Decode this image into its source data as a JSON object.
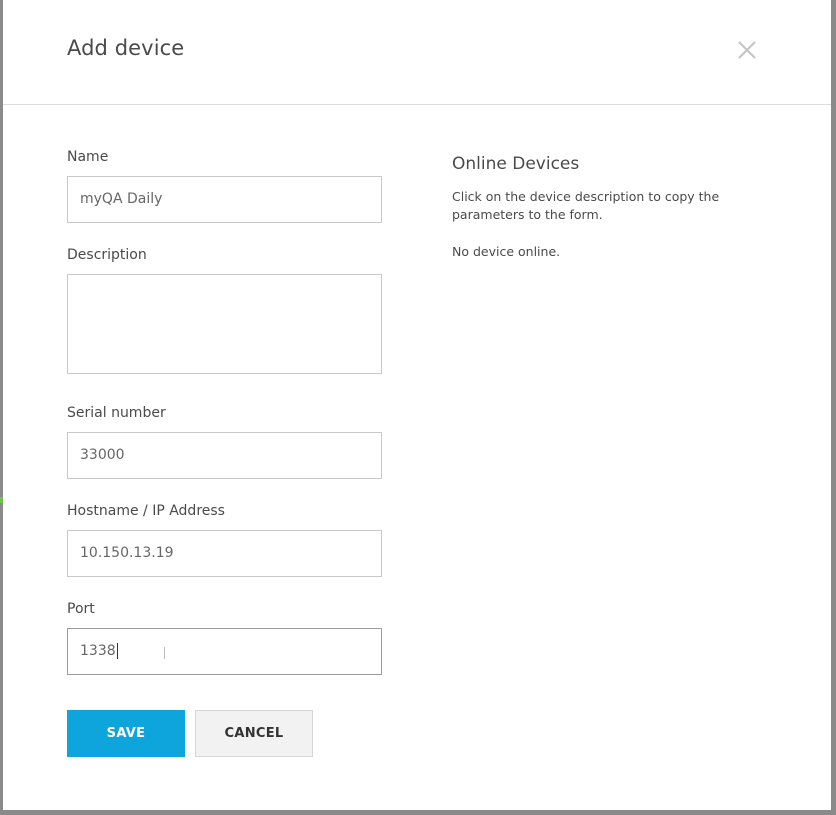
{
  "dialog": {
    "title": "Add device",
    "close_icon": "close-icon"
  },
  "form": {
    "name": {
      "label": "Name",
      "value": "myQA Daily"
    },
    "description": {
      "label": "Description",
      "value": ""
    },
    "serial": {
      "label": "Serial number",
      "value": "33000"
    },
    "hostname": {
      "label": "Hostname / IP Address",
      "value": "10.150.13.19"
    },
    "port": {
      "label": "Port",
      "value": "1338"
    }
  },
  "actions": {
    "save_label": "SAVE",
    "cancel_label": "CANCEL"
  },
  "online": {
    "title": "Online Devices",
    "help": "Click on the device description to copy the parameters to the form.",
    "status": "No device online."
  },
  "colors": {
    "primary": "#0ea5dd",
    "text": "#4a4a4a",
    "border": "#c9c9c9"
  }
}
